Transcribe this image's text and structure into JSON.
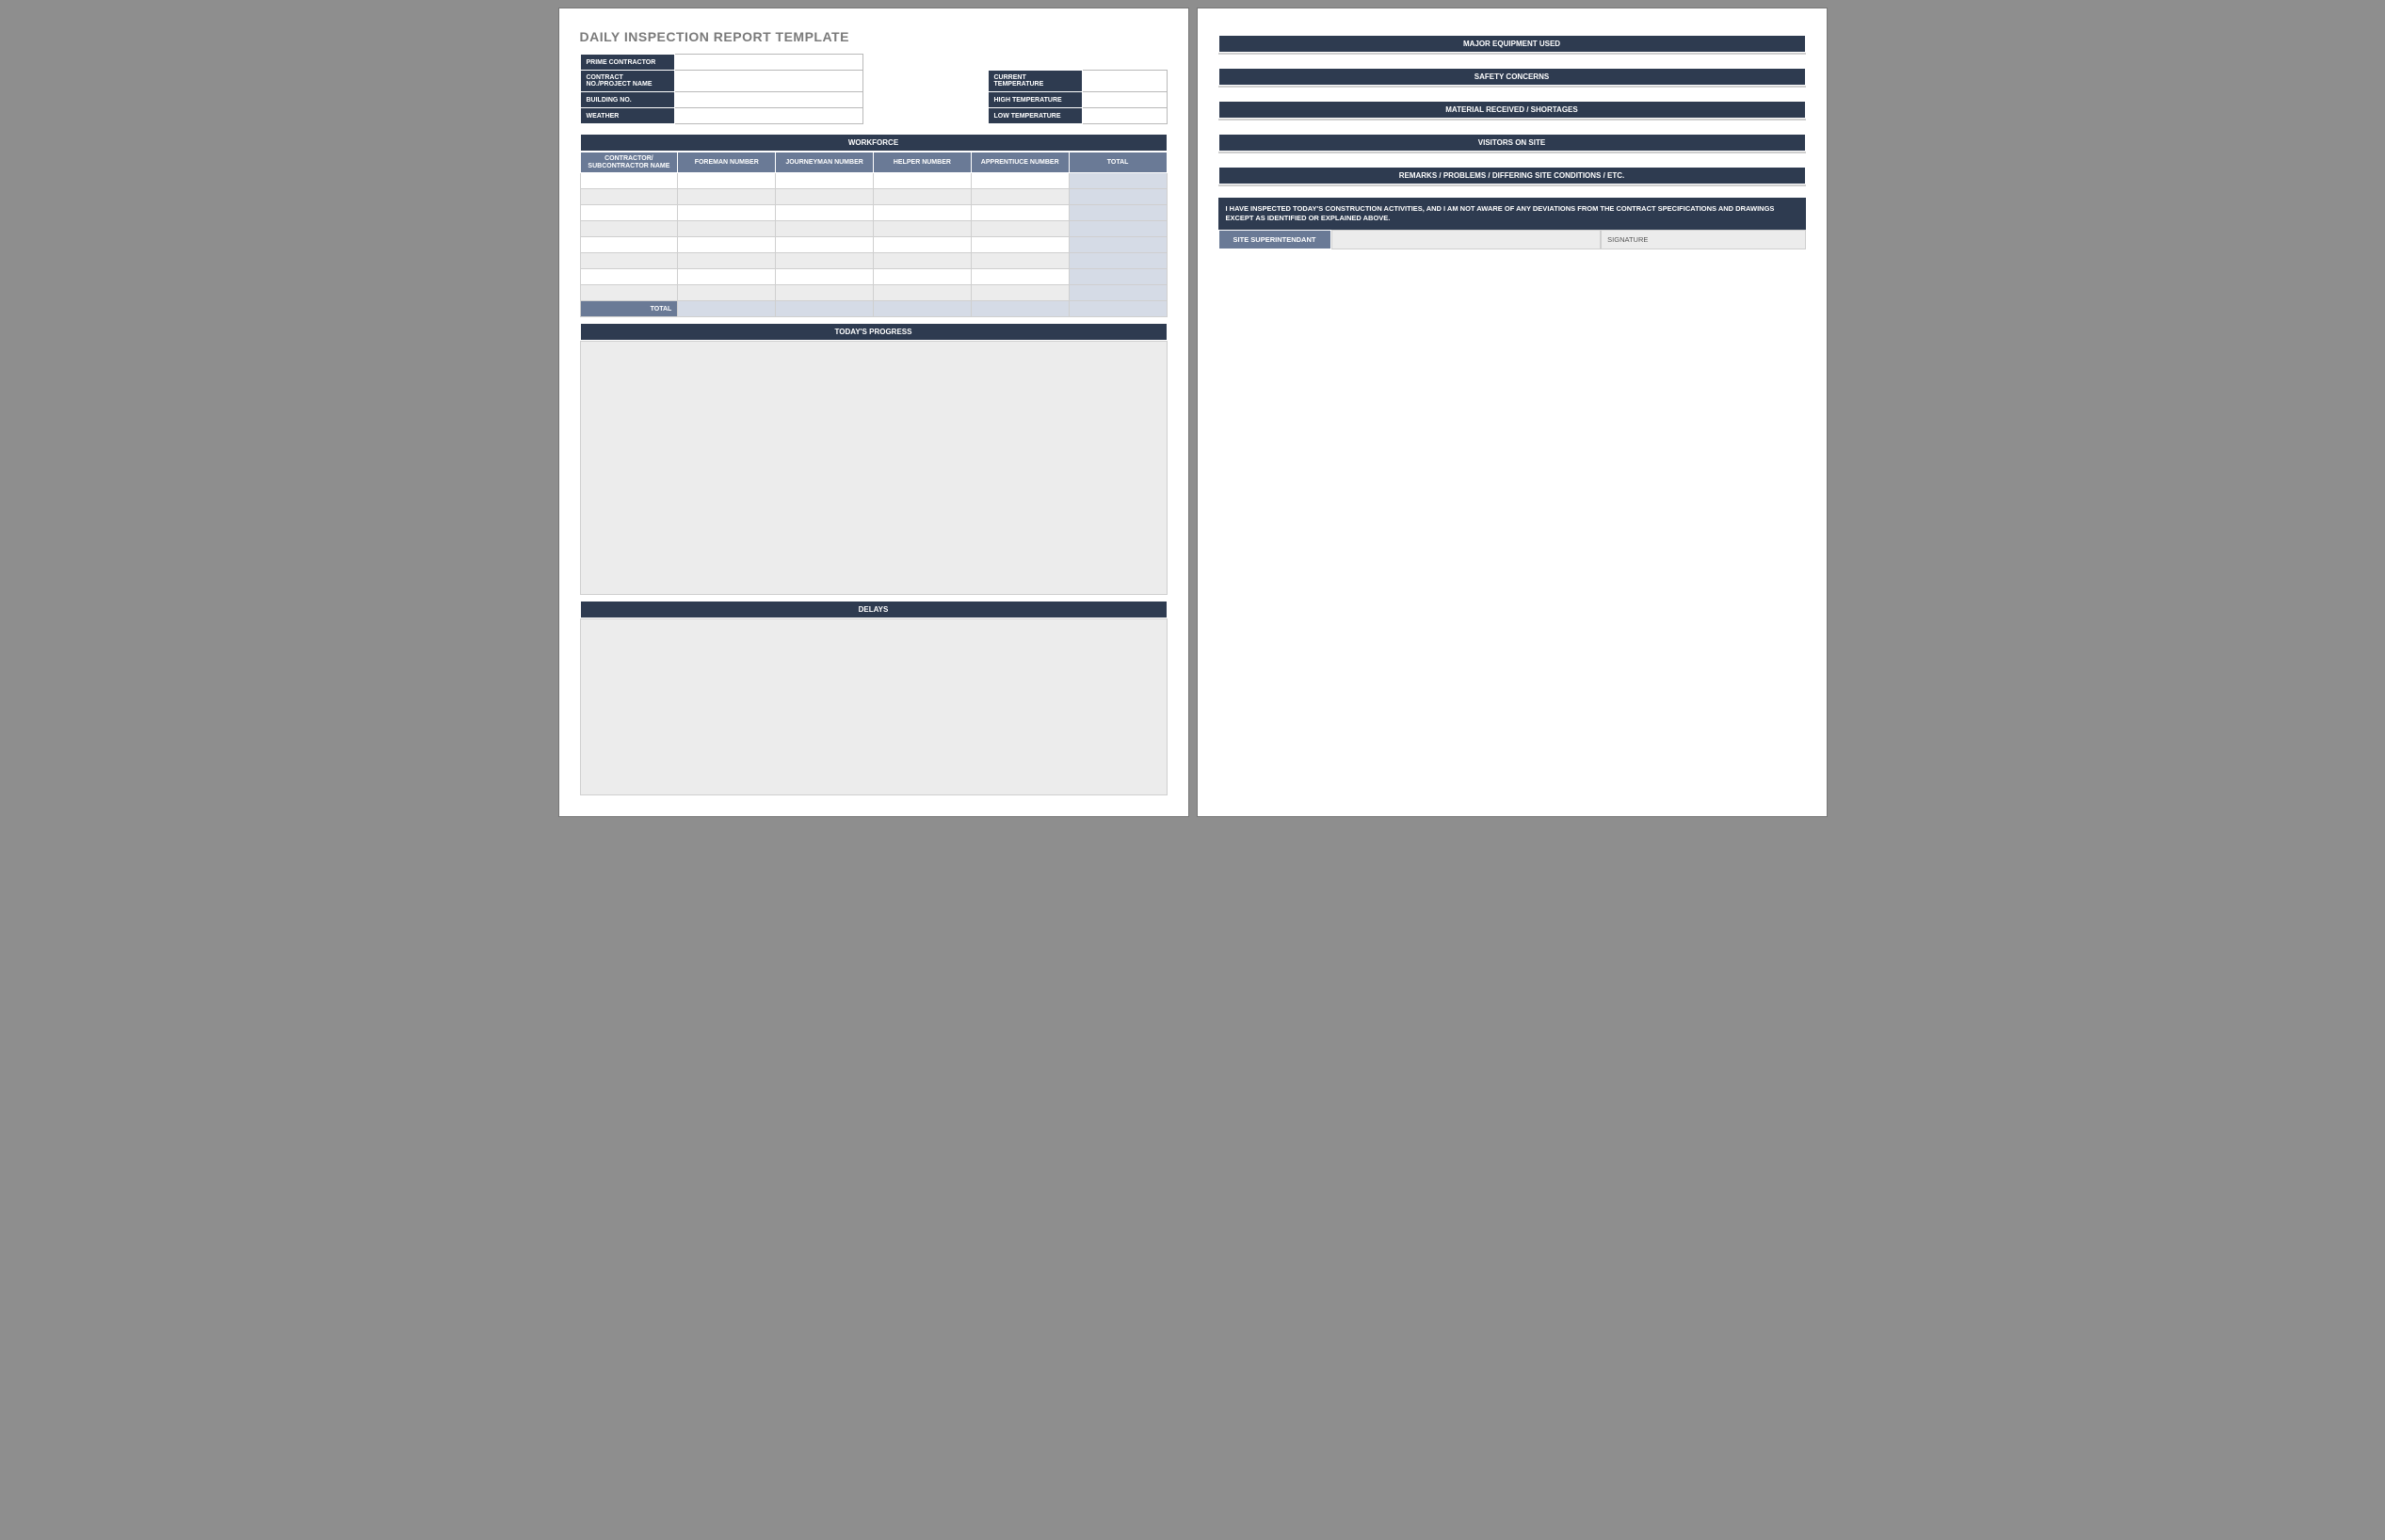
{
  "title": "DAILY INSPECTION REPORT TEMPLATE",
  "meta_left": {
    "prime_contractor": "PRIME CONTRACTOR",
    "contract_no": "CONTRACT NO./PROJECT NAME",
    "building_no": "BUILDING NO.",
    "weather": "WEATHER"
  },
  "meta_right": {
    "current_temp": "CURRENT TEMPERATURE",
    "high_temp": "HIGH TEMPERATURE",
    "low_temp": "LOW TEMPERATURE"
  },
  "workforce": {
    "header": "WORKFORCE",
    "cols": {
      "contractor": "CONTRACTOR/ SUBCONTRACTOR NAME",
      "foreman": "FOREMAN NUMBER",
      "journeyman": "JOURNEYMAN NUMBER",
      "helper": "HELPER NUMBER",
      "apprentice": "APPRENTIUCE NUMBER",
      "total": "TOTAL"
    },
    "total_label": "TOTAL"
  },
  "sections": {
    "todays_progress": "TODAY'S PROGRESS",
    "delays": "DELAYS",
    "major_equipment": "MAJOR EQUIPMENT USED",
    "safety_concerns": "SAFETY CONCERNS",
    "material": "MATERIAL RECEIVED / SHORTAGES",
    "visitors": "VISITORS ON SITE",
    "remarks": "REMARKS / PROBLEMS / DIFFERING SITE CONDITIONS / ETC."
  },
  "certification": "I HAVE INSPECTED TODAY'S CONSTRUCTION ACTIVITIES, AND I AM NOT AWARE OF ANY DEVIATIONS FROM THE CONTRACT SPECIFICATIONS AND DRAWINGS EXCEPT AS IDENTIFIED OR EXPLAINED ABOVE.",
  "signature": {
    "role": "SITE SUPERINTENDANT",
    "sig_label": "SIGNATURE"
  }
}
